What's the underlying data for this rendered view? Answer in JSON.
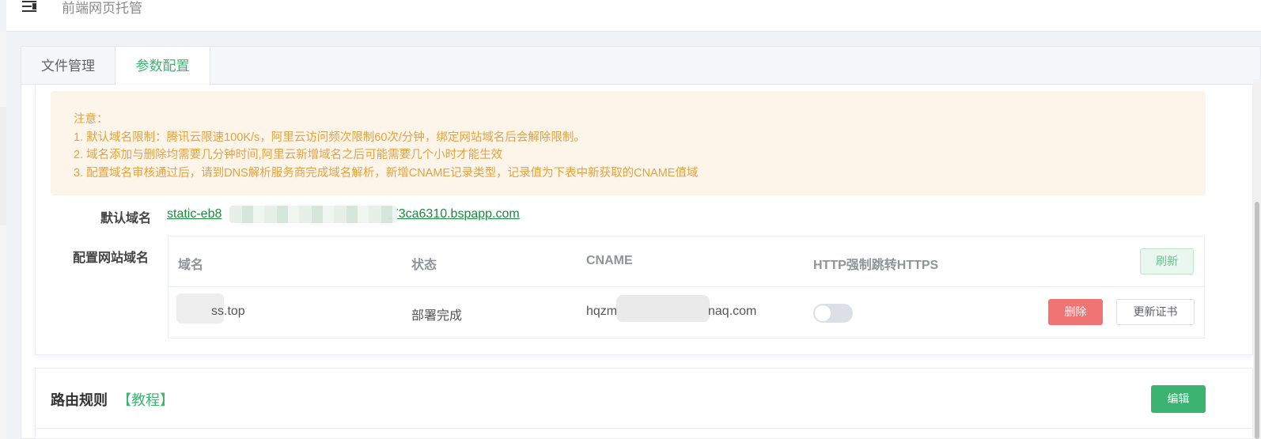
{
  "header": {
    "title": "前端网页托管"
  },
  "tabs": [
    {
      "label": "文件管理",
      "active": false
    },
    {
      "label": "参数配置",
      "active": true
    }
  ],
  "notice": {
    "title": "注意：",
    "lines": [
      "1. 默认域名限制：腾讯云限速100K/s，阿里云访问频次限制60次/分钟，绑定网站域名后会解除限制。",
      "2. 域名添加与删除均需要几分钟时间,阿里云新增域名之后可能需要几个小时才能生效",
      "3. 配置域名审核通过后，请到DNS解析服务商完成域名解析，新增CNAME记录类型，记录值为下表中新获取的CNAME值域"
    ]
  },
  "default_domain": {
    "label": "默认域名",
    "value_prefix": "static-eb8",
    "value_suffix": ".73ca6310.bspapp.com"
  },
  "site_domain": {
    "label": "配置网站域名",
    "columns": [
      "域名",
      "状态",
      "CNAME",
      "HTTP强制跳转HTTPS"
    ],
    "refresh_label": "刷新",
    "rows": [
      {
        "domain": "ss.top",
        "status": "部署完成",
        "cname_prefix": "hqzm",
        "cname_suffix": "naq.com",
        "https_redirect": false,
        "delete_label": "删除",
        "cert_label": "更新证书"
      }
    ]
  },
  "routes": {
    "title": "路由规则",
    "tutorial_label": "【教程】",
    "edit_label": "编辑"
  },
  "colors": {
    "accent": "#3cb371",
    "warning_text": "#e6a23c",
    "warning_bg": "#fdf4ea",
    "danger": "#f07474",
    "link": "#1b8a3f"
  }
}
